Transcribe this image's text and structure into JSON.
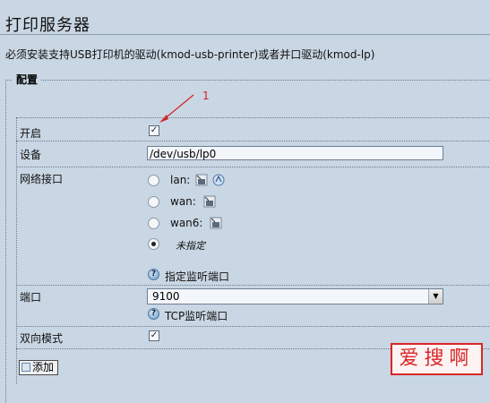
{
  "page": {
    "title": "打印服务器",
    "description": "必须安装支持USB打印机的驱动(kmod-usb-printer)或者并口驱动(kmod-lp)"
  },
  "config": {
    "legend": "配置",
    "annotation_number": "1",
    "enable": {
      "label": "开启",
      "checked": true
    },
    "device": {
      "label": "设备",
      "value": "/dev/usb/lp0"
    },
    "interface": {
      "label": "网络接口",
      "options": [
        {
          "label": "lan:",
          "checked": false
        },
        {
          "label": "wan:",
          "checked": false
        },
        {
          "label": "wan6:",
          "checked": false
        },
        {
          "label": "未指定",
          "checked": true
        }
      ],
      "help": "指定监听端口"
    },
    "port": {
      "label": "端口",
      "value": "9100",
      "help": "TCP监听端口"
    },
    "bidirectional": {
      "label": "双向模式",
      "checked": true
    },
    "add_button": "添加"
  },
  "watermark": "爱搜啊"
}
